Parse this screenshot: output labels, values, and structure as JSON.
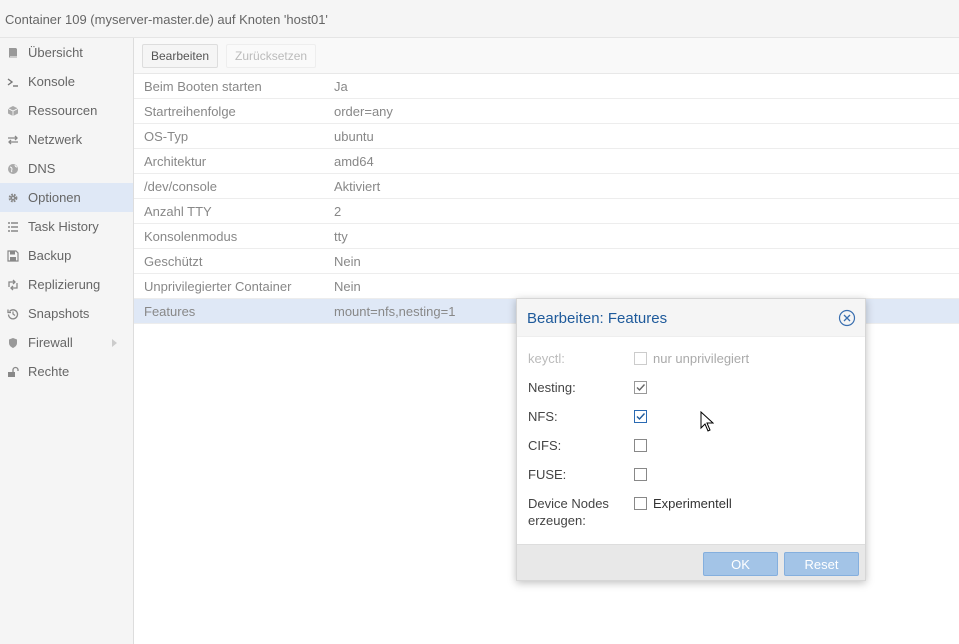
{
  "window": {
    "title": "Container 109 (myserver-master.de) auf Knoten 'host01'"
  },
  "sidebar": {
    "items": [
      {
        "label": "Übersicht",
        "icon": "book-icon"
      },
      {
        "label": "Konsole",
        "icon": "terminal-icon"
      },
      {
        "label": "Ressourcen",
        "icon": "cube-icon"
      },
      {
        "label": "Netzwerk",
        "icon": "exchange-icon"
      },
      {
        "label": "DNS",
        "icon": "globe-icon"
      },
      {
        "label": "Optionen",
        "icon": "gear-icon",
        "active": true
      },
      {
        "label": "Task History",
        "icon": "list-icon"
      },
      {
        "label": "Backup",
        "icon": "floppy-icon"
      },
      {
        "label": "Replizierung",
        "icon": "retweet-icon"
      },
      {
        "label": "Snapshots",
        "icon": "history-icon"
      },
      {
        "label": "Firewall",
        "icon": "shield-icon",
        "submenu": true
      },
      {
        "label": "Rechte",
        "icon": "unlock-icon"
      }
    ]
  },
  "toolbar": {
    "edit_label": "Bearbeiten",
    "revert_label": "Zurücksetzen"
  },
  "options": {
    "rows": [
      {
        "key": "Beim Booten starten",
        "value": "Ja"
      },
      {
        "key": "Startreihenfolge",
        "value": "order=any"
      },
      {
        "key": "OS-Typ",
        "value": "ubuntu"
      },
      {
        "key": "Architektur",
        "value": "amd64"
      },
      {
        "key": "/dev/console",
        "value": "Aktiviert"
      },
      {
        "key": "Anzahl TTY",
        "value": "2"
      },
      {
        "key": "Konsolenmodus",
        "value": "tty"
      },
      {
        "key": "Geschützt",
        "value": "Nein"
      },
      {
        "key": "Unprivilegierter Container",
        "value": "Nein"
      },
      {
        "key": "Features",
        "value": "mount=nfs,nesting=1",
        "selected": true
      }
    ]
  },
  "dialog": {
    "title": "Bearbeiten: Features",
    "keyctl_label": "keyctl:",
    "keyctl_box": "nur unprivilegiert",
    "nesting_label": "Nesting:",
    "nfs_label": "NFS:",
    "cifs_label": "CIFS:",
    "fuse_label": "FUSE:",
    "devnodes_label_1": "Device Nodes",
    "devnodes_label_2": "erzeugen:",
    "devnodes_box": "Experimentell",
    "ok_label": "OK",
    "reset_label": "Reset"
  },
  "colors": {
    "accent": "#1e5a9b",
    "selected_row": "#dfe8f6",
    "button": "#a3c4e7"
  }
}
